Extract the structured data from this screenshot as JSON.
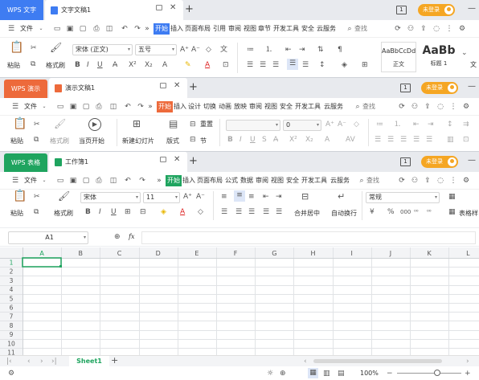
{
  "colors": {
    "writer": "#3e7cf2",
    "presentation": "#ed6a3b",
    "sheet": "#1fa45f",
    "accent": "#f5a623"
  },
  "writer": {
    "app_tab": "WPS 文字",
    "doc_tab": "文字文稿1",
    "win_count": "1",
    "login": "未登录",
    "menu_file": "文件",
    "menu_tabs": [
      "开始",
      "插入",
      "页面布局",
      "引用",
      "审阅",
      "视图",
      "章节",
      "开发工具",
      "安全",
      "云服务"
    ],
    "search": "查找",
    "paste": "粘贴",
    "format_painter": "格式刷",
    "font": "宋体 (正文)",
    "font_size": "五号",
    "style_normal_preview": "AaBbCcDd",
    "style_normal": "正文",
    "style_h1_preview": "AaBb",
    "style_h1": "标题 1",
    "style_more": "文"
  },
  "presentation": {
    "app_tab": "WPS 演示",
    "doc_tab": "演示文稿1",
    "win_count": "1",
    "login": "未登录",
    "menu_file": "文件",
    "menu_tabs": [
      "开始",
      "插入",
      "设计",
      "切换",
      "动画",
      "放映",
      "审阅",
      "视图",
      "安全",
      "开发工具",
      "云服务"
    ],
    "search": "查找",
    "paste": "粘贴",
    "format_painter": "格式刷",
    "play": "当页开始",
    "new_slide": "新建幻灯片",
    "layout": "版式",
    "reset": "重置",
    "section": "节",
    "font_size": "0"
  },
  "sheet": {
    "app_tab": "WPS 表格",
    "doc_tab": "工作簿1",
    "win_count": "1",
    "login": "未登录",
    "menu_file": "文件",
    "menu_tabs": [
      "开始",
      "插入",
      "页面布局",
      "公式",
      "数据",
      "审阅",
      "视图",
      "安全",
      "开发工具",
      "云服务"
    ],
    "search": "查找",
    "paste": "粘贴",
    "format_painter": "格式刷",
    "font": "宋体",
    "font_size": "11",
    "merge": "合并居中",
    "wrap": "自动换行",
    "number_format": "常规",
    "table_style": "表格样",
    "name_box": "A1",
    "fx": "fx",
    "columns": [
      "A",
      "B",
      "C",
      "D",
      "E",
      "F",
      "G",
      "H",
      "I",
      "J",
      "K",
      "L"
    ],
    "rows": [
      "1",
      "2",
      "3",
      "4",
      "5",
      "6",
      "7",
      "8",
      "9",
      "10",
      "11"
    ],
    "sheet_tab": "Sheet1",
    "zoom": "100%"
  }
}
